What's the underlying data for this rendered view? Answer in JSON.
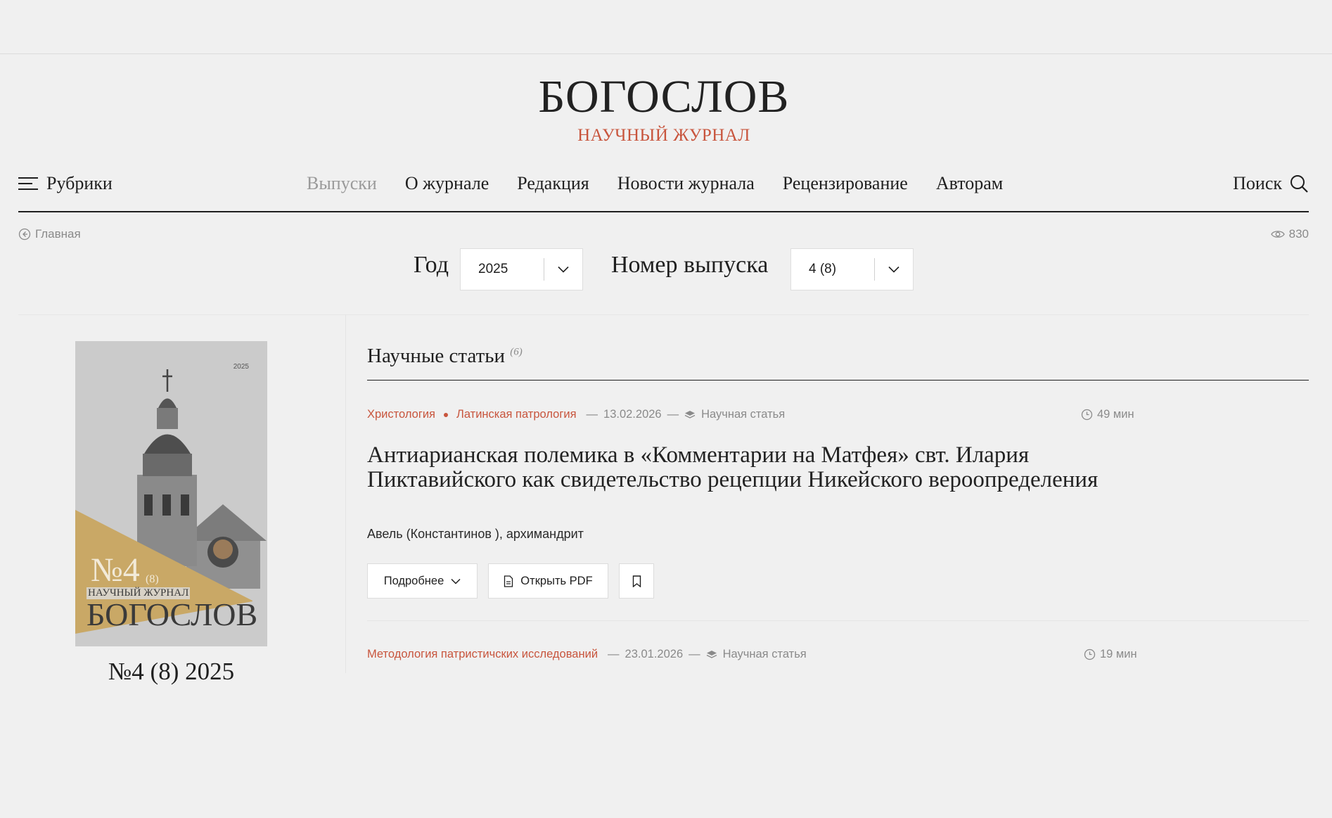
{
  "logo": {
    "title": "БОГОСЛОВ",
    "subtitle": "НАУЧНЫЙ ЖУРНАЛ"
  },
  "nav": {
    "rubrics_label": "Рубрики",
    "items": [
      {
        "label": "Выпуски",
        "active": true
      },
      {
        "label": "О журнале"
      },
      {
        "label": "Редакция"
      },
      {
        "label": "Новости журнала"
      },
      {
        "label": "Рецензирование"
      },
      {
        "label": "Авторам"
      }
    ],
    "search_label": "Поиск"
  },
  "breadcrumb": {
    "label": "Главная"
  },
  "views": {
    "count": "830"
  },
  "filters": {
    "year_label": "Год",
    "year_value": "2025",
    "issue_label": "Номер выпуска",
    "issue_value": "4 (8)"
  },
  "issue": {
    "cover": {
      "year": "2025",
      "number": "№4",
      "number_sub": "(8)",
      "journal_line": "НАУЧНЫЙ ЖУРНАЛ",
      "title": "БОГОСЛОВ"
    },
    "caption": "№4 (8) 2025"
  },
  "section": {
    "title": "Научные статьи",
    "count": "(6)"
  },
  "articles": [
    {
      "rubrics": [
        "Христология",
        "Латинская патрология"
      ],
      "date": "13.02.2026",
      "type": "Научная статья",
      "read_time": "49 мин",
      "title": "Антиарианская полемика в «Комментарии на Матфея» свт. Илария Пиктавийского как свидетельство рецепции Никейского вероопределения",
      "author": "Авель (Константинов ), архимандрит",
      "buttons": {
        "more": "Подробнее",
        "pdf": "Открыть PDF"
      }
    },
    {
      "rubrics": [
        "Методология патристичских исследований"
      ],
      "date": "23.01.2026",
      "type": "Научная статья",
      "read_time": "19 мин"
    }
  ],
  "colors": {
    "accent": "#c8553d",
    "cover_band": "#c9a866",
    "background": "#f0f0f0"
  }
}
